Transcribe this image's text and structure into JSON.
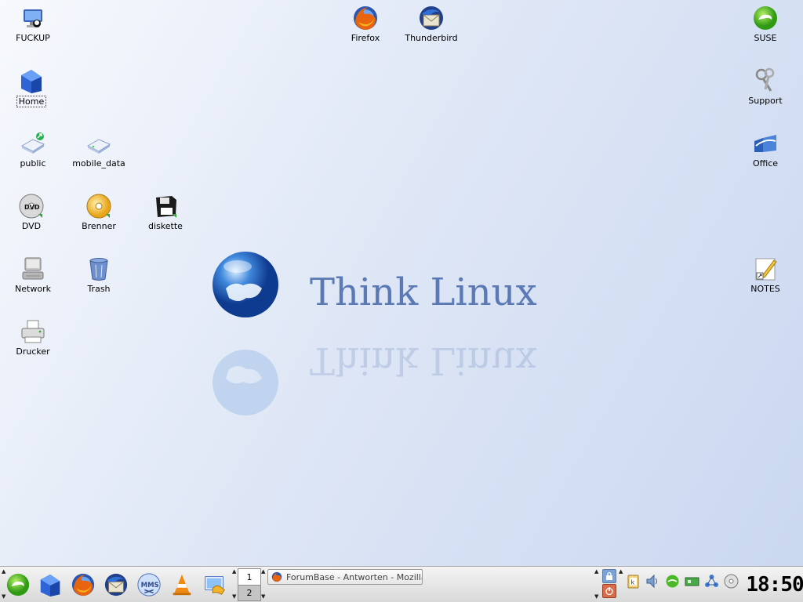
{
  "desktop": {
    "icons": [
      {
        "label": "FUCKUP",
        "icon": "computer-icon"
      },
      {
        "label": "Home",
        "icon": "home-icon"
      },
      {
        "label": "public",
        "icon": "network-share-icon"
      },
      {
        "label": "mobile_data",
        "icon": "drive-icon"
      },
      {
        "label": "DVD",
        "icon": "dvd-icon"
      },
      {
        "label": "Brenner",
        "icon": "cd-burner-icon"
      },
      {
        "label": "diskette",
        "icon": "floppy-icon"
      },
      {
        "label": "Network",
        "icon": "network-icon"
      },
      {
        "label": "Trash",
        "icon": "trash-icon"
      },
      {
        "label": "Drucker",
        "icon": "printer-icon"
      },
      {
        "label": "Firefox",
        "icon": "firefox-icon"
      },
      {
        "label": "Thunderbird",
        "icon": "thunderbird-icon"
      },
      {
        "label": "SUSE",
        "icon": "suse-icon"
      },
      {
        "label": "Support",
        "icon": "keys-icon"
      },
      {
        "label": "Office",
        "icon": "office-icon"
      },
      {
        "label": "NOTES",
        "icon": "notes-icon"
      }
    ]
  },
  "wallpaper": {
    "text": "Think Linux",
    "color": "#5a79b5"
  },
  "taskbar": {
    "launchers": [
      "suse-menu-icon",
      "home-icon",
      "firefox-icon",
      "thunderbird-icon",
      "mms-icon",
      "vlc-icon",
      "screenshot-icon"
    ],
    "pager": [
      "1",
      "2"
    ],
    "active_page": "2",
    "task": {
      "title": "ForumBase - Antworten - Mozilla",
      "icon": "firefox-icon"
    },
    "tray": [
      "klipper-icon",
      "volume-icon",
      "suse-updater-icon",
      "network-card-icon",
      "network-manager-icon",
      "cd-icon"
    ],
    "clock": "18:50"
  }
}
